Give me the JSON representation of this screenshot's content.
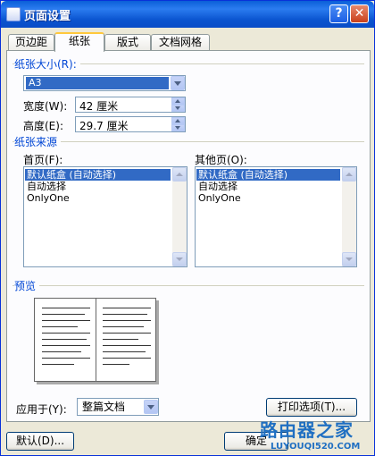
{
  "window": {
    "title": "页面设置"
  },
  "tabs": [
    {
      "label": "页边距"
    },
    {
      "label": "纸张"
    },
    {
      "label": "版式"
    },
    {
      "label": "文档网格"
    }
  ],
  "paper_size": {
    "group_title": "纸张大小(R):",
    "selected": "A3",
    "width_label": "宽度(W):",
    "width_value": "42 厘米",
    "height_label": "高度(E):",
    "height_value": "29.7 厘米"
  },
  "paper_source": {
    "group_title": "纸张来源",
    "first_page_label": "首页(F):",
    "other_pages_label": "其他页(O):",
    "options": [
      "默认纸盒 (自动选择)",
      "自动选择",
      "OnlyOne"
    ]
  },
  "preview": {
    "title": "预览"
  },
  "apply_to": {
    "label": "应用于(Y):",
    "value": "整篇文档"
  },
  "buttons": {
    "print_options": "打印选项(T)...",
    "default": "默认(D)...",
    "ok": "确定"
  },
  "watermark": {
    "main": "路由器之家",
    "sub": "LUYOUQI520.COM"
  }
}
